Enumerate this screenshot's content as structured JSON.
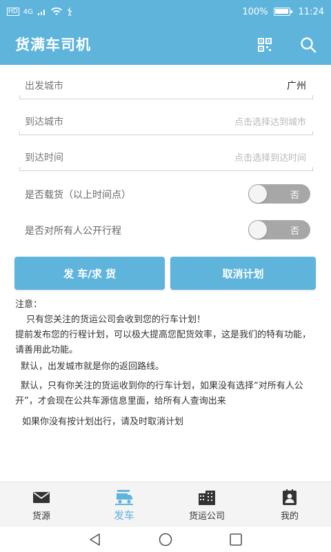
{
  "status_bar": {
    "left_badge": "HD",
    "network": "4G",
    "battery": "100%",
    "time": "11:24"
  },
  "app_bar": {
    "title": "货满车司机",
    "icons": [
      "qr-scan-icon",
      "search-icon"
    ]
  },
  "form": {
    "departure_city": {
      "label": "出发城市",
      "value": "广州"
    },
    "arrival_city": {
      "label": "到达城市",
      "placeholder": "点击选择达到城市"
    },
    "arrival_time": {
      "label": "到达时间",
      "placeholder": "点击选择到达时间"
    },
    "loaded": {
      "label": "是否载货（以上时间点）",
      "state": "否",
      "on": false
    },
    "public_route": {
      "label": "是否对所有人公开行程",
      "state": "否",
      "on": false
    }
  },
  "buttons": {
    "submit": "发 车/求 货",
    "cancel": "取消计划"
  },
  "notice": {
    "heading": "注意：",
    "lines": [
      "只有您关注的货运公司会收到您的行车计划！",
      "提前发布您的行程计划，可以极大提高您配货效率，这是我们的特有功能，请善用此功能。",
      "默认，出发城市就是你的返回路线。",
      "默认，只有你关注的货运收到你的行车计划，如果没有选择“对所有人公开”，才会现在公共车源信息里面，给所有人查询出来",
      "如果你没有按计划出行，请及时取消计划"
    ]
  },
  "tabs": [
    {
      "label": "货源",
      "icon": "mail-icon",
      "active": false
    },
    {
      "label": "发车",
      "icon": "truck-icon",
      "active": true
    },
    {
      "label": "货运公司",
      "icon": "building-icon",
      "active": false
    },
    {
      "label": "我的",
      "icon": "contact-card-icon",
      "active": false
    }
  ],
  "colors": {
    "primary": "#5fb4dc",
    "switch_off": "#a7a7a7",
    "tab_bar_bg": "#f4f4f4"
  }
}
